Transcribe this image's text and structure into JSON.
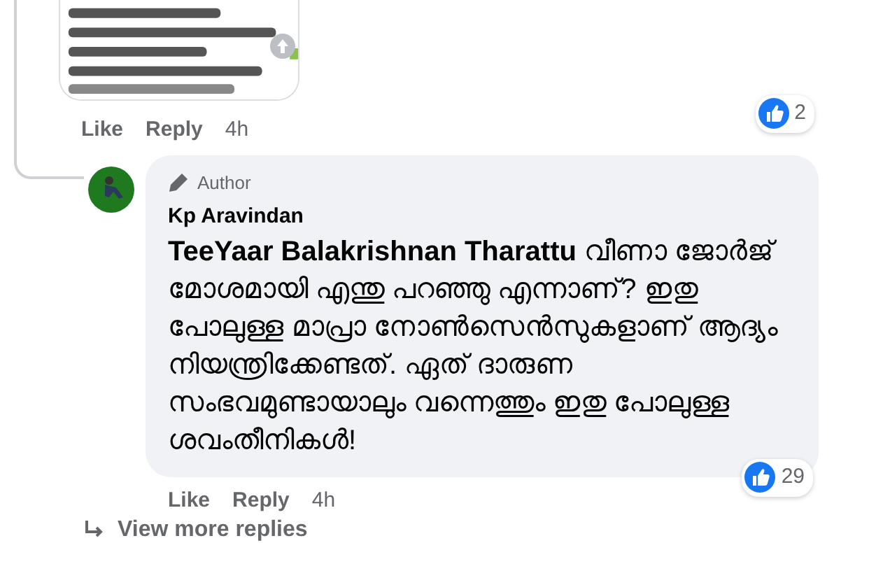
{
  "comments": [
    {
      "actions": [
        {
          "label": "Like"
        },
        {
          "label": "Reply"
        }
      ],
      "time": "4h",
      "reaction_count": "2"
    },
    {
      "author_badge": "Author",
      "name": "Kp Aravindan",
      "message": "**TeeYaar Balakrishnan Tharattu** വീണാ ജോർജ് മോശമായി എന്തു പറഞ്ഞു എന്നാണ്? ഇതു പോലുള്ള മാപ്രാ നോൺസെൻസുകളാണ് ആദ്യം നിയന്ത്രിക്കേണ്ടത്. ഏത് ദാരുണ സംഭവമുണ്ടായാലും വന്നെത്തും ഇതു പോലുള്ള ശവംതീനികൾ!",
      "actions": [
        {
          "label": "Like"
        },
        {
          "label": "Reply"
        }
      ],
      "time": "4h",
      "reaction_count": "29"
    }
  ],
  "view_more": "View more replies"
}
